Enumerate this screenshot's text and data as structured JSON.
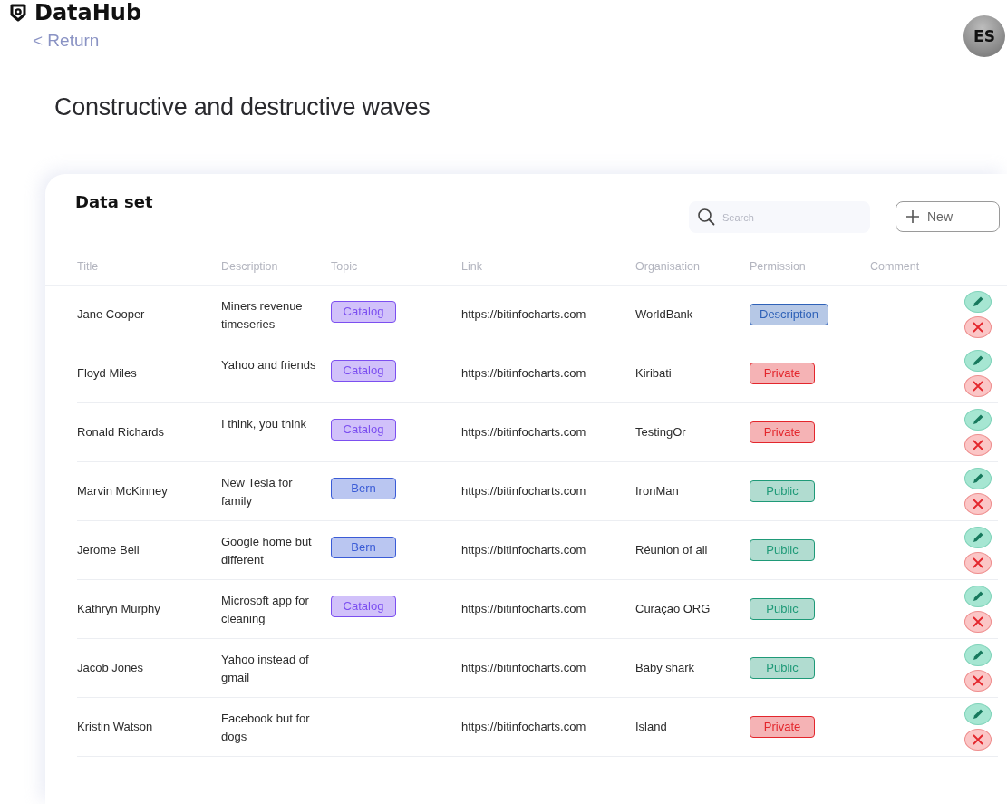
{
  "brand": {
    "name": "DataHub"
  },
  "back_link": "< Return",
  "user": {
    "initials": "ES"
  },
  "page_title": "Constructive and destructive waves",
  "dataset": {
    "title": "Data set",
    "search": {
      "placeholder": "Search"
    },
    "new_button": "New",
    "columns": [
      "Title",
      "Description",
      "Topic",
      "Link",
      "Organisation",
      "Permission",
      "Comment"
    ],
    "rows": [
      {
        "title": "Jane Cooper",
        "description": "Miners revenue timeseries",
        "topic": {
          "label": "Catalog",
          "color": "#7c4ff0"
        },
        "link": "https://bitinfocharts.com",
        "organisation": "WorldBank",
        "permission": {
          "label": "Description",
          "color": "#2f62b8"
        }
      },
      {
        "title": "Floyd Miles",
        "description": "Yahoo and friends",
        "topic": {
          "label": "Catalog",
          "color": "#7c4ff0"
        },
        "link": "https://bitinfocharts.com",
        "organisation": "Kiribati",
        "permission": {
          "label": "Private",
          "color": "#e3262c"
        }
      },
      {
        "title": "Ronald Richards",
        "description": "I think, you think",
        "topic": {
          "label": "Catalog",
          "color": "#7c4ff0"
        },
        "link": "https://bitinfocharts.com",
        "organisation": "TestingOr",
        "permission": {
          "label": "Private",
          "color": "#e3262c"
        }
      },
      {
        "title": "Marvin McKinney",
        "description": "New Tesla for family",
        "topic": {
          "label": "Bern",
          "color": "#3a5bd6"
        },
        "link": "https://bitinfocharts.com",
        "organisation": "IronMan",
        "permission": {
          "label": "Public",
          "color": "#1f9a78"
        }
      },
      {
        "title": "Jerome Bell",
        "description": "Google home but different",
        "topic": {
          "label": "Bern",
          "color": "#3a5bd6"
        },
        "link": "https://bitinfocharts.com",
        "organisation": "Réunion of all",
        "permission": {
          "label": "Public",
          "color": "#1f9a78"
        }
      },
      {
        "title": "Kathryn Murphy",
        "description": "Microsoft app for  cleaning",
        "topic": {
          "label": "Catalog",
          "color": "#7c4ff0"
        },
        "link": "https://bitinfocharts.com",
        "organisation": "Curaçao ORG",
        "permission": {
          "label": "Public",
          "color": "#1f9a78"
        }
      },
      {
        "title": "Jacob Jones",
        "description": "Yahoo instead of gmail",
        "link": "https://bitinfocharts.com",
        "organisation": "Baby shark",
        "permission": {
          "label": "Public",
          "color": "#1f9a78"
        }
      },
      {
        "title": "Kristin Watson",
        "description": "Facebook but for dogs",
        "link": "https://bitinfocharts.com",
        "organisation": "Island",
        "permission": {
          "label": "Private",
          "color": "#e3262c"
        }
      }
    ]
  }
}
